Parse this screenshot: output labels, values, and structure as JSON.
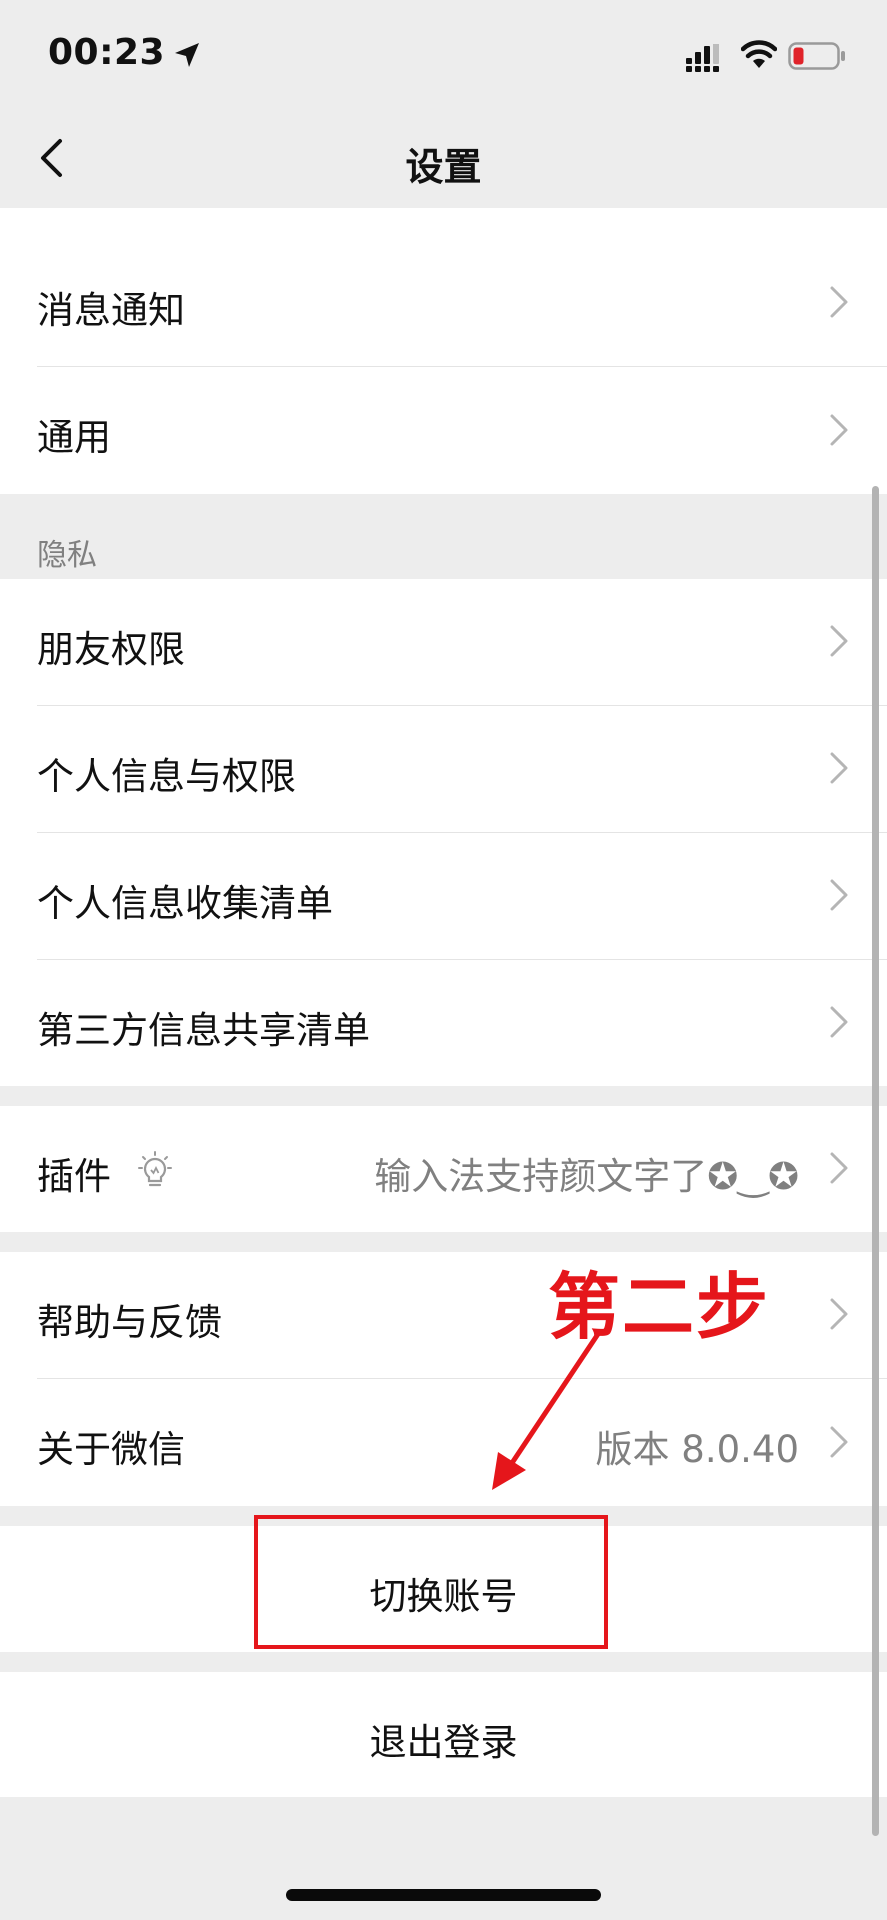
{
  "status_bar": {
    "time": "00:23"
  },
  "header": {
    "title": "设置"
  },
  "group1": {
    "items": [
      {
        "label": "消息通知"
      },
      {
        "label": "通用"
      }
    ]
  },
  "privacy": {
    "title": "隐私",
    "items": [
      {
        "label": "朋友权限"
      },
      {
        "label": "个人信息与权限"
      },
      {
        "label": "个人信息收集清单"
      },
      {
        "label": "第三方信息共享清单"
      }
    ]
  },
  "plugins": {
    "label": "插件",
    "value": "输入法支持颜文字了✪‿✪"
  },
  "help": {
    "label": "帮助与反馈"
  },
  "about": {
    "label": "关于微信",
    "value": "版本 8.0.40"
  },
  "switch_account": {
    "label": "切换账号"
  },
  "logout": {
    "label": "退出登录"
  },
  "annotation": {
    "text": "第二步",
    "color": "#e5161b"
  }
}
